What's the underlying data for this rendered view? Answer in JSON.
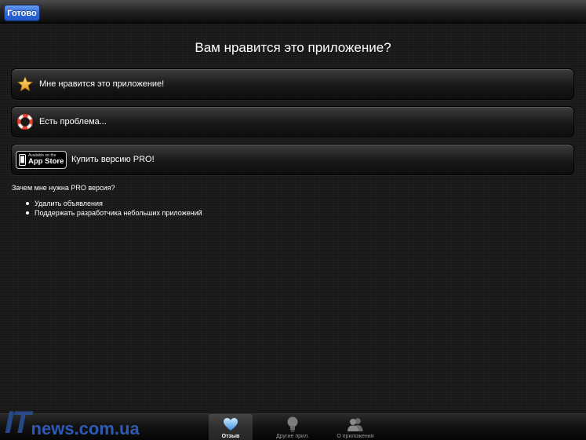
{
  "toolbar": {
    "done_label": "Готово"
  },
  "question": "Вам нравится это приложение?",
  "options": [
    {
      "label": "Мне нравится это приложение!",
      "icon": "star-icon"
    },
    {
      "label": "Есть проблема...",
      "icon": "lifebuoy-icon"
    },
    {
      "label": "Купить версию PRO!",
      "icon": "app-store-badge"
    }
  ],
  "app_store_badge": {
    "small": "Available on the",
    "big": "App Store"
  },
  "pro_info": {
    "question": "Зачем мне нужна PRO версия?",
    "bullets": [
      "Удалить объявления",
      "Поддержать разработчика небольших приложений"
    ]
  },
  "tabs": [
    {
      "label": "Отзыв",
      "icon": "heart-icon",
      "active": true
    },
    {
      "label": "Другие прил.",
      "icon": "lightbulb-icon",
      "active": false
    },
    {
      "label": "О приложении",
      "icon": "people-icon",
      "active": false
    }
  ],
  "watermark": {
    "prefix": "IT",
    "rest": "news.com.ua"
  },
  "colors": {
    "accent": "#2f6ad8",
    "background": "#1b1b1b",
    "watermark": "#2e5ab4"
  }
}
